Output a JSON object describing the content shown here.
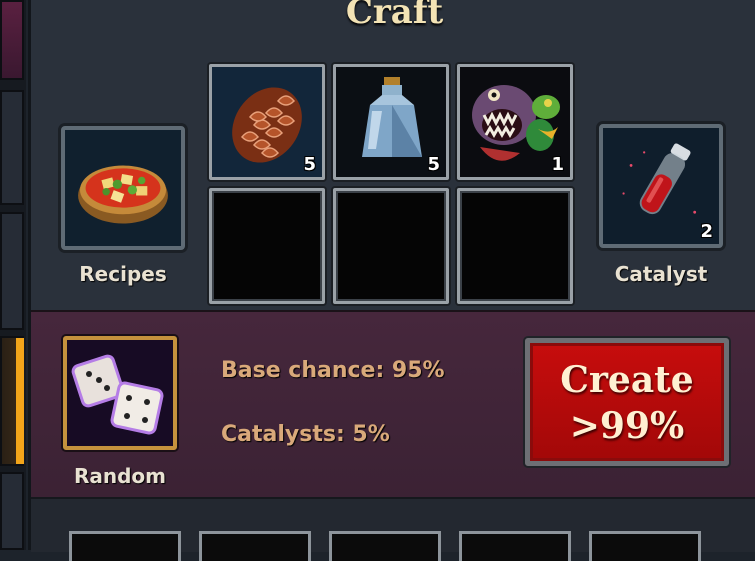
{
  "title": "Craft",
  "ingredients": [
    {
      "icon": "pine-cone-icon",
      "qty": "5"
    },
    {
      "icon": "glass-bottle-icon",
      "qty": "5"
    },
    {
      "icon": "fish-monster-icon",
      "qty": "1"
    },
    {
      "icon": "",
      "qty": ""
    },
    {
      "icon": "",
      "qty": ""
    },
    {
      "icon": "",
      "qty": ""
    }
  ],
  "recipes": {
    "label": "Recipes",
    "icon": "soup-bowl-icon"
  },
  "catalyst": {
    "label": "Catalyst",
    "icon": "red-potion-icon",
    "qty": "2"
  },
  "random": {
    "label": "Random",
    "icon": "dice-icon"
  },
  "base_chance": "Base chance: 95%",
  "catalysts_chance": "Catalysts: 5%",
  "create_button": {
    "line1": "Create",
    "line2": ">99%"
  },
  "colors": {
    "create_red": "#b80a0a",
    "panel": "#2a313b",
    "lower_panel": "#46273c",
    "accent_gold": "#c5923d"
  }
}
